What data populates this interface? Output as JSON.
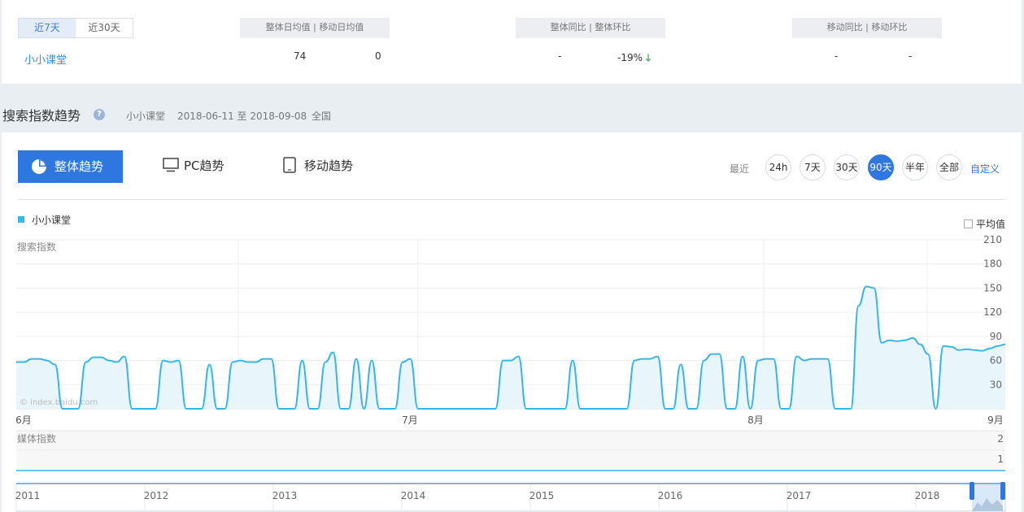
{
  "summary": {
    "range_tabs": [
      {
        "label": "近7天",
        "active": true
      },
      {
        "label": "近30天",
        "active": false
      }
    ],
    "keyword": "小小课堂",
    "headers": {
      "daily": "整体日均值   |   移动日均值",
      "yoy": "整体同比   |   整体环比",
      "mobile": "移动同比   |   移动环比"
    },
    "values": {
      "overall_daily": "74",
      "mobile_daily": "0",
      "overall_yoy": "-",
      "overall_mom": "-19%",
      "mobile_yoy": "-",
      "mobile_mom": "-"
    }
  },
  "section": {
    "title": "搜索指数趋势",
    "keyword": "小小课堂",
    "date_range": "2018-06-11 至 2018-09-08",
    "region": "全国"
  },
  "tabs": {
    "overall": "整体趋势",
    "pc": "PC趋势",
    "mobile": "移动趋势"
  },
  "range": {
    "label": "最近",
    "options": [
      {
        "label": "24h",
        "active": false
      },
      {
        "label": "7天",
        "active": false
      },
      {
        "label": "30天",
        "active": false
      },
      {
        "label": "90天",
        "active": true
      },
      {
        "label": "半年",
        "active": false
      },
      {
        "label": "全部",
        "active": false
      }
    ],
    "custom": "自定义"
  },
  "legend": {
    "series": "小小课堂",
    "average": "平均值"
  },
  "watermark": "© index.baidu.com",
  "chart_data": [
    {
      "type": "area",
      "ylabel": "搜索指数",
      "ylim": [
        0,
        210
      ],
      "yticks": [
        30,
        60,
        90,
        120,
        150,
        180,
        210
      ],
      "xticks": [
        "6月",
        "7月",
        "8月",
        "9月"
      ],
      "x_range": [
        "2018-06-11",
        "2018-09-08"
      ],
      "series": [
        {
          "name": "小小课堂",
          "color": "#39b6e8",
          "values": [
            58,
            58,
            62,
            62,
            60,
            55,
            0,
            0,
            0,
            58,
            64,
            64,
            60,
            58,
            65,
            0,
            0,
            0,
            0,
            60,
            58,
            60,
            0,
            0,
            0,
            55,
            0,
            0,
            58,
            60,
            58,
            58,
            62,
            62,
            0,
            0,
            0,
            60,
            0,
            0,
            58,
            70,
            0,
            0,
            62,
            0,
            60,
            0,
            0,
            0,
            58,
            62,
            0,
            0,
            0,
            0,
            0,
            0,
            0,
            0,
            0,
            0,
            0,
            60,
            60,
            65,
            0,
            0,
            0,
            0,
            0,
            0,
            60,
            0,
            0,
            0,
            0,
            0,
            0,
            0,
            60,
            62,
            62,
            65,
            0,
            0,
            55,
            0,
            0,
            60,
            68,
            68,
            0,
            0,
            65,
            0,
            60,
            62,
            62,
            0,
            0,
            65,
            60,
            62,
            62,
            62,
            0,
            0,
            0,
            128,
            152,
            150,
            82,
            85,
            84,
            85,
            88,
            80,
            68,
            0,
            78,
            77,
            73,
            74,
            73,
            72,
            75,
            78,
            80
          ]
        }
      ]
    },
    {
      "type": "line",
      "ylabel": "媒体指数",
      "ylim": [
        0,
        2
      ],
      "yticks": [
        1,
        2
      ],
      "series": [
        {
          "name": "",
          "values": [
            0,
            0
          ]
        }
      ]
    },
    {
      "type": "area",
      "role": "range-navigator",
      "xticks": [
        "2011",
        "2012",
        "2013",
        "2014",
        "2015",
        "2016",
        "2017",
        "2018"
      ]
    }
  ],
  "colors": {
    "accent": "#2f77e0",
    "series": "#39b6e8",
    "down_arrow": "#2bb34a"
  }
}
